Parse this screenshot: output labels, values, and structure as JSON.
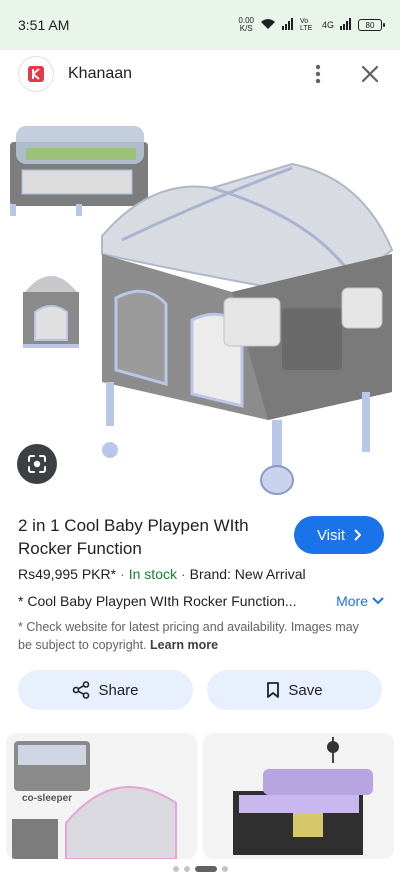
{
  "status": {
    "time": "3:51 AM",
    "speed_value": "0.00",
    "speed_unit": "K/S",
    "network": "4G",
    "volte": "Vo LTE",
    "battery": "80"
  },
  "header": {
    "site_name": "Khanaan",
    "logo_letter": "K"
  },
  "product": {
    "title": "2 in 1 Cool Baby Playpen WIth Rocker Function",
    "visit_label": "Visit",
    "price": "Rs49,995 PKR*",
    "stock": "In stock",
    "brand": "Brand: New Arrival",
    "description": "* Cool Baby Playpen WIth Rocker Function...",
    "more_label": "More",
    "disclaimer": "* Check website for latest pricing and availability. Images may be subject to copyright.",
    "learn_more": "Learn more"
  },
  "actions": {
    "share_label": "Share",
    "save_label": "Save"
  },
  "related": {
    "card1_label": "co-sleeper"
  },
  "colors": {
    "accent": "#1a73e8",
    "stock_green": "#188038",
    "chip_bg": "#e8f0fe",
    "status_bg": "#e9f5ea"
  }
}
